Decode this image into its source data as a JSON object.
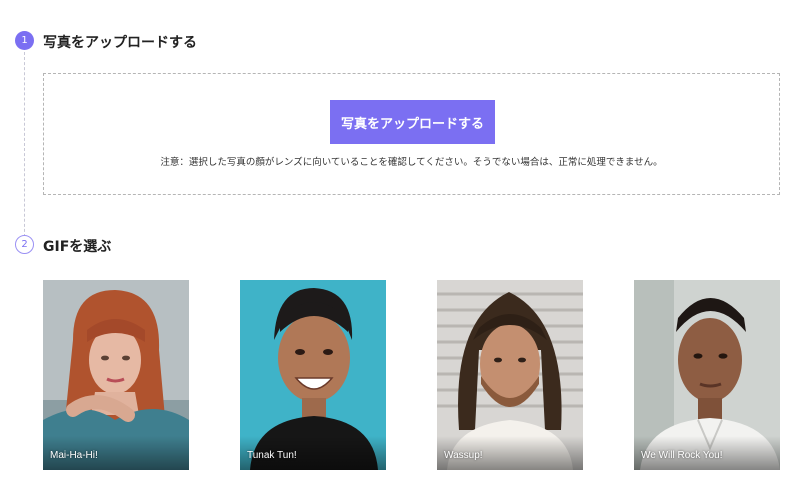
{
  "steps": {
    "upload": {
      "number": "1",
      "title": "写真をアップロードする",
      "button_label": "写真をアップロードする",
      "note": "注意：選択した写真の顔がレンズに向いていることを確認してください。そうでない場合は、正常に処理できません。"
    },
    "gif": {
      "number": "2",
      "title": "GIFを選ぶ"
    }
  },
  "gifs": [
    {
      "caption": "Mai-Ha-Hi!"
    },
    {
      "caption": "Tunak Tun!"
    },
    {
      "caption": "Wassup!"
    },
    {
      "caption": "We Will Rock You!"
    }
  ],
  "colors": {
    "accent": "#7b6ff2",
    "dashed_border": "#b5b5b5"
  }
}
